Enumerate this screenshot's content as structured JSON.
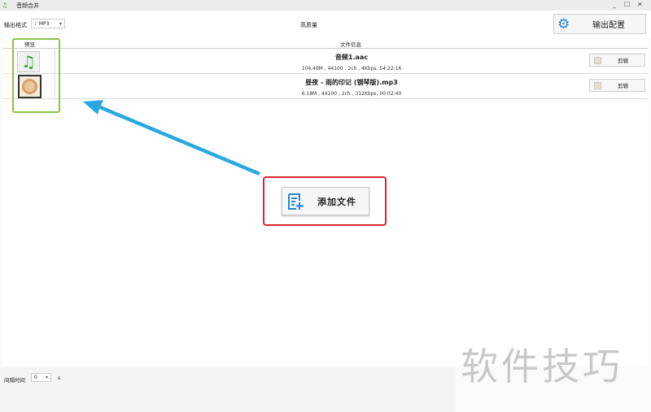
{
  "window": {
    "title": "音频合并",
    "minimize": "_",
    "maximize": "☐",
    "close": "✕"
  },
  "toolbar": {
    "format_label": "输出格式",
    "format_value": "MP3",
    "quality_label": "高质量",
    "config_button": "输出配置"
  },
  "list": {
    "headers": {
      "preview": "预览",
      "info": "文件信息"
    },
    "rows": [
      {
        "name": "音频1.aac",
        "info": "104.49M , 44100 , 2ch , 4Kbps, 54:22:16",
        "edit": "剪辑",
        "thumb": "music-note-file-icon"
      },
      {
        "name": "昼夜 - 雨的印记 (钢琴版).mp3",
        "info": "6.18M , 44100 , 2ch , 312Kbps, 00:02:40",
        "edit": "剪辑",
        "thumb": "album-cover"
      }
    ]
  },
  "add_button": "添加文件",
  "footer": {
    "interval_label": "间隔时间",
    "interval_value": "0",
    "unit": "s"
  },
  "watermark": "软件技巧",
  "colors": {
    "highlight_green": "#8bc34a",
    "highlight_red": "#d9252b",
    "arrow": "#29a8e0",
    "accent": "#1e88d6"
  }
}
